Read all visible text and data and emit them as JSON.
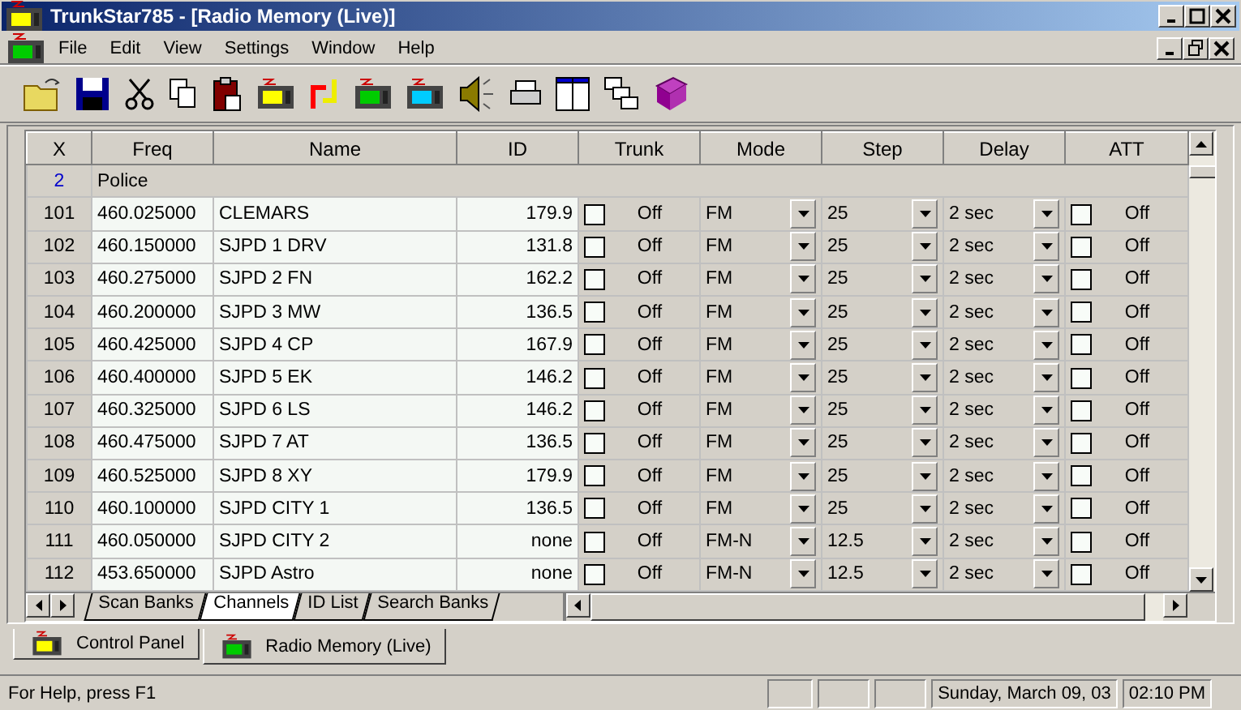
{
  "window": {
    "title": "TrunkStar785 - [Radio Memory (Live)]"
  },
  "menu": [
    "File",
    "Edit",
    "View",
    "Settings",
    "Window",
    "Help"
  ],
  "table": {
    "columns": [
      "X",
      "Freq",
      "Name",
      "ID",
      "Trunk",
      "Mode",
      "Step",
      "Delay",
      "ATT"
    ],
    "group": {
      "number": "2",
      "name": "Police"
    },
    "rows": [
      {
        "num": "101",
        "freq": "460.025000",
        "name": "CLEMARS",
        "id": "179.9",
        "trunk": {
          "checked": false,
          "label": "Off"
        },
        "mode": "FM",
        "step": "25",
        "delay": "2 sec",
        "att": {
          "checked": false,
          "label": "Off"
        }
      },
      {
        "num": "102",
        "freq": "460.150000",
        "name": "SJPD 1 DRV",
        "id": "131.8",
        "trunk": {
          "checked": false,
          "label": "Off"
        },
        "mode": "FM",
        "step": "25",
        "delay": "2 sec",
        "att": {
          "checked": false,
          "label": "Off"
        }
      },
      {
        "num": "103",
        "freq": "460.275000",
        "name": "SJPD 2 FN",
        "id": "162.2",
        "trunk": {
          "checked": false,
          "label": "Off"
        },
        "mode": "FM",
        "step": "25",
        "delay": "2 sec",
        "att": {
          "checked": false,
          "label": "Off"
        }
      },
      {
        "num": "104",
        "freq": "460.200000",
        "name": "SJPD 3 MW",
        "id": "136.5",
        "trunk": {
          "checked": false,
          "label": "Off"
        },
        "mode": "FM",
        "step": "25",
        "delay": "2 sec",
        "att": {
          "checked": false,
          "label": "Off"
        }
      },
      {
        "num": "105",
        "freq": "460.425000",
        "name": "SJPD 4 CP",
        "id": "167.9",
        "trunk": {
          "checked": false,
          "label": "Off"
        },
        "mode": "FM",
        "step": "25",
        "delay": "2 sec",
        "att": {
          "checked": false,
          "label": "Off"
        }
      },
      {
        "num": "106",
        "freq": "460.400000",
        "name": "SJPD 5 EK",
        "id": "146.2",
        "trunk": {
          "checked": false,
          "label": "Off"
        },
        "mode": "FM",
        "step": "25",
        "delay": "2 sec",
        "att": {
          "checked": false,
          "label": "Off"
        }
      },
      {
        "num": "107",
        "freq": "460.325000",
        "name": "SJPD 6 LS",
        "id": "146.2",
        "trunk": {
          "checked": false,
          "label": "Off"
        },
        "mode": "FM",
        "step": "25",
        "delay": "2 sec",
        "att": {
          "checked": false,
          "label": "Off"
        }
      },
      {
        "num": "108",
        "freq": "460.475000",
        "name": "SJPD 7 AT",
        "id": "136.5",
        "trunk": {
          "checked": false,
          "label": "Off"
        },
        "mode": "FM",
        "step": "25",
        "delay": "2 sec",
        "att": {
          "checked": false,
          "label": "Off"
        }
      },
      {
        "num": "109",
        "freq": "460.525000",
        "name": "SJPD 8 XY",
        "id": "179.9",
        "trunk": {
          "checked": false,
          "label": "Off"
        },
        "mode": "FM",
        "step": "25",
        "delay": "2 sec",
        "att": {
          "checked": false,
          "label": "Off"
        }
      },
      {
        "num": "110",
        "freq": "460.100000",
        "name": "SJPD CITY 1",
        "id": "136.5",
        "trunk": {
          "checked": false,
          "label": "Off"
        },
        "mode": "FM",
        "step": "25",
        "delay": "2 sec",
        "att": {
          "checked": false,
          "label": "Off"
        }
      },
      {
        "num": "111",
        "freq": "460.050000",
        "name": "SJPD CITY 2",
        "id": "none",
        "trunk": {
          "checked": false,
          "label": "Off"
        },
        "mode": "FM-N",
        "step": "12.5",
        "delay": "2 sec",
        "att": {
          "checked": false,
          "label": "Off"
        }
      },
      {
        "num": "112",
        "freq": "453.650000",
        "name": "SJPD Astro",
        "id": "none",
        "trunk": {
          "checked": false,
          "label": "Off"
        },
        "mode": "FM-N",
        "step": "12.5",
        "delay": "2 sec",
        "att": {
          "checked": false,
          "label": "Off"
        }
      }
    ]
  },
  "sheet_tabs": [
    {
      "label": "Scan Banks",
      "selected": false
    },
    {
      "label": "Channels",
      "selected": true
    },
    {
      "label": "ID List",
      "selected": false
    },
    {
      "label": "Search Banks",
      "selected": false
    }
  ],
  "window_tabs": [
    {
      "label": "Control Panel",
      "selected": false
    },
    {
      "label": "Radio Memory (Live)",
      "selected": true
    }
  ],
  "status_bar": {
    "help": "For Help, press F1",
    "date": "Sunday, March 09, 03",
    "time": "02:10 PM"
  }
}
